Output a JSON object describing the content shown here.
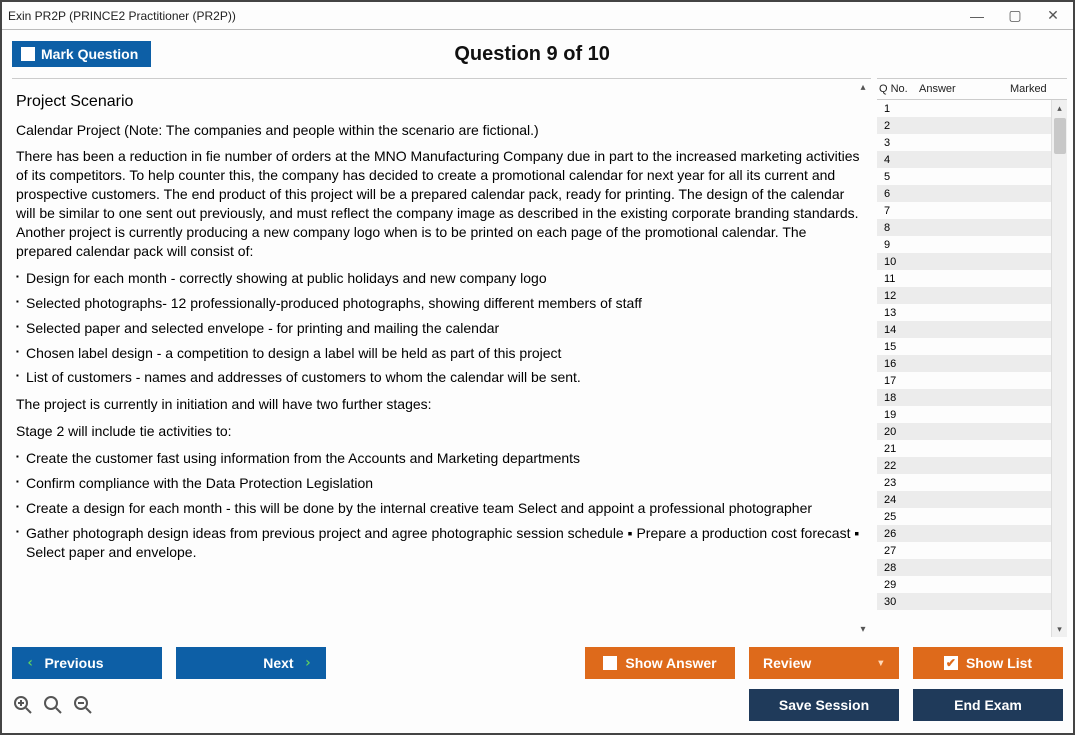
{
  "window": {
    "title": "Exin PR2P (PRINCE2 Practitioner (PR2P))"
  },
  "header": {
    "mark_label": "Mark Question",
    "question_title": "Question 9 of 10"
  },
  "content": {
    "p0": "Project Scenario",
    "p1": "Calendar Project (Note: The companies and people within the scenario are fictional.)",
    "p2": "There has been a reduction in fie number of orders at the MNO Manufacturing Company due in part to the increased marketing activities of its competitors. To help counter this, the company has decided to create a promotional calendar for next year for all its current and prospective customers. The end product of this project will be a prepared calendar pack, ready for printing. The design of the calendar will be similar to one sent out previously, and must reflect the company image as described in the existing corporate branding standards. Another project is currently producing a new company logo when is to be printed on each page of the promotional calendar. The prepared calendar pack will consist of:",
    "l1_0": "Design for each month - correctly showing at public holidays and new company logo",
    "l1_1": "Selected photographs- 12 professionally-produced photographs, showing different members of staff",
    "l1_2": "Selected paper and selected envelope - for printing and mailing the calendar",
    "l1_3": "Chosen label design - a competition to design a label will be held as part of this project",
    "l1_4": "List of customers - names and addresses of customers to whom the calendar will be sent.",
    "p3": "The project is currently in initiation and will have two further stages:",
    "p4": "Stage 2 will include tie activities to:",
    "l2_0": "Create the customer fast using information from the Accounts and Marketing departments",
    "l2_1": "Confirm compliance with the Data Protection Legislation",
    "l2_2": "Create a design for each month - this will be done by the internal creative team Select and appoint a professional photographer",
    "l2_3": "Gather photograph design ideas from previous project and agree photographic session schedule ▪ Prepare a production cost forecast ▪ Select paper and envelope."
  },
  "side": {
    "head_qno": "Q No.",
    "head_ans": "Answer",
    "head_mark": "Marked",
    "rows": [
      "1",
      "2",
      "3",
      "4",
      "5",
      "6",
      "7",
      "8",
      "9",
      "10",
      "11",
      "12",
      "13",
      "14",
      "15",
      "16",
      "17",
      "18",
      "19",
      "20",
      "21",
      "22",
      "23",
      "24",
      "25",
      "26",
      "27",
      "28",
      "29",
      "30"
    ]
  },
  "footer": {
    "previous": "Previous",
    "next": "Next",
    "show_answer": "Show Answer",
    "review": "Review",
    "show_list": "Show List",
    "save_session": "Save Session",
    "end_exam": "End Exam"
  }
}
